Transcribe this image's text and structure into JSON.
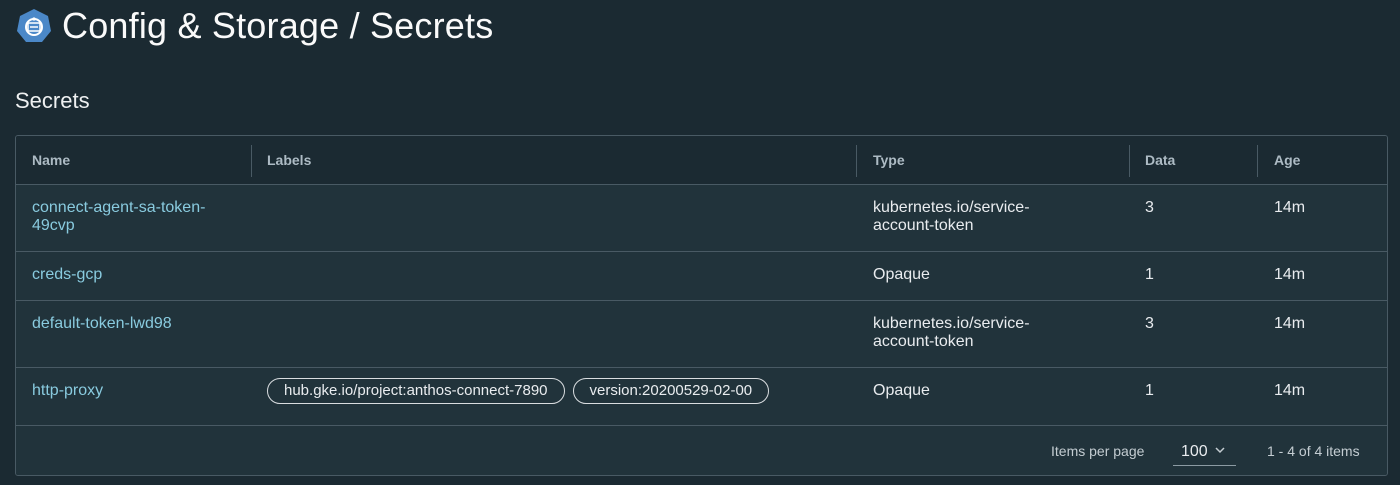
{
  "header": {
    "title": "Config & Storage / Secrets",
    "logo_icon": "kubernetes-logo-icon"
  },
  "section": {
    "title": "Secrets"
  },
  "table": {
    "columns": [
      "Name",
      "Labels",
      "Type",
      "Data",
      "Age"
    ],
    "rows": [
      {
        "name": "connect-agent-sa-token-49cvp",
        "labels": [],
        "type": "kubernetes.io/service-account-token",
        "data": "3",
        "age": "14m"
      },
      {
        "name": "creds-gcp",
        "labels": [],
        "type": "Opaque",
        "data": "1",
        "age": "14m"
      },
      {
        "name": "default-token-lwd98",
        "labels": [],
        "type": "kubernetes.io/service-account-token",
        "data": "3",
        "age": "14m"
      },
      {
        "name": "http-proxy",
        "labels": [
          "hub.gke.io/project:anthos-connect-7890",
          "version:20200529-02-00"
        ],
        "type": "Opaque",
        "data": "1",
        "age": "14m"
      }
    ]
  },
  "pagination": {
    "items_per_page_label": "Items per page",
    "items_per_page_value": "100",
    "range_text": "1 - 4 of 4 items"
  },
  "colors": {
    "background": "#1b2a32",
    "table_background": "#21333b",
    "border": "#495a64",
    "link": "#89cbdf",
    "logo": "#4b88c8"
  }
}
